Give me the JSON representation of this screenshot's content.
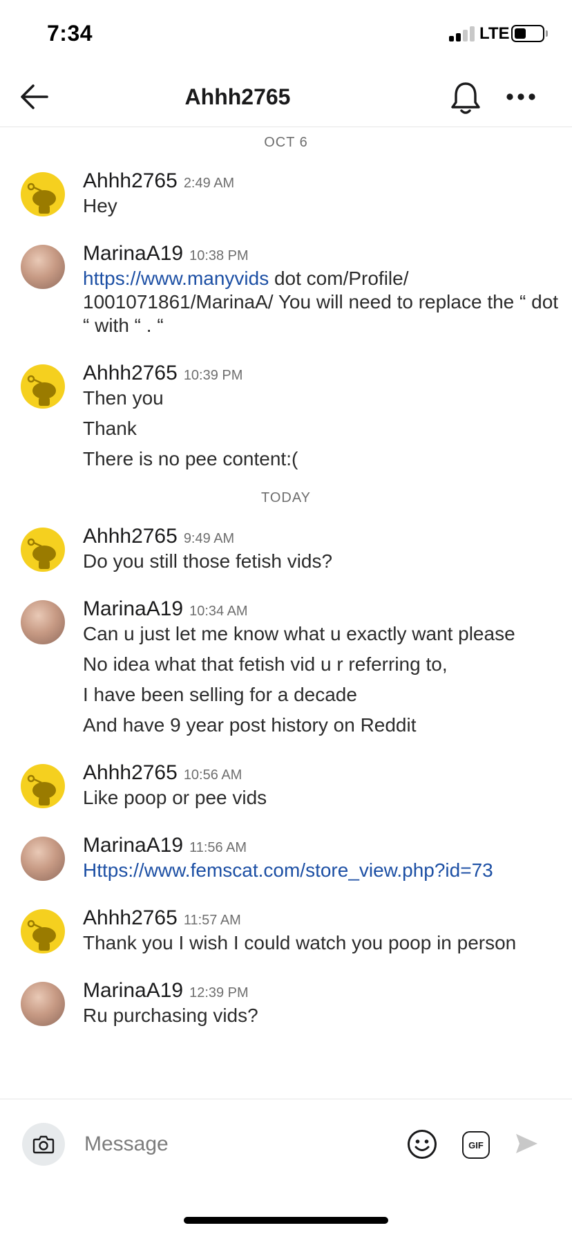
{
  "status_bar": {
    "time": "7:34",
    "network": "LTE"
  },
  "header": {
    "title": "Ahhh2765"
  },
  "chat": {
    "sections": [
      {
        "date": "OCT 6",
        "groups": [
          {
            "user": "Ahhh2765",
            "avatar": "snoo-avatar-icon",
            "time": "2:49 AM",
            "lines": [
              {
                "text": "Hey"
              }
            ]
          },
          {
            "user": "MarinaA19",
            "avatar": "photo-avatar",
            "time": "10:38 PM",
            "lines": [
              {
                "link": "https://www.manyvids",
                "text": " dot com/Profile/ 1001071861/MarinaA/  You will need to replace the “ dot “ with “ . “"
              }
            ]
          },
          {
            "user": "Ahhh2765",
            "avatar": "snoo-avatar-icon",
            "time": "10:39 PM",
            "lines": [
              {
                "text": "Then you"
              },
              {
                "text": "Thank"
              },
              {
                "text": "There is no pee content:("
              }
            ]
          }
        ]
      },
      {
        "date": "TODAY",
        "groups": [
          {
            "user": "Ahhh2765",
            "avatar": "snoo-avatar-icon",
            "time": "9:49 AM",
            "lines": [
              {
                "text": "Do you still those fetish vids?"
              }
            ]
          },
          {
            "user": "MarinaA19",
            "avatar": "photo-avatar",
            "time": "10:34 AM",
            "lines": [
              {
                "text": "Can u just let me know what u exactly want please"
              },
              {
                "text": "No idea what that fetish vid u r referring to,"
              },
              {
                "text": "I have been selling for a decade"
              },
              {
                "text": "And have 9 year post history on Reddit"
              }
            ]
          },
          {
            "user": "Ahhh2765",
            "avatar": "snoo-avatar-icon",
            "time": "10:56 AM",
            "lines": [
              {
                "text": "Like poop or pee vids"
              }
            ]
          },
          {
            "user": "MarinaA19",
            "avatar": "photo-avatar",
            "time": "11:56 AM",
            "lines": [
              {
                "link": "Https://www.femscat.com/store_view.php?id=73",
                "text": ""
              }
            ]
          },
          {
            "user": "Ahhh2765",
            "avatar": "snoo-avatar-icon",
            "time": "11:57 AM",
            "lines": [
              {
                "text": "Thank you I wish I could watch you poop in person"
              }
            ]
          },
          {
            "user": "MarinaA19",
            "avatar": "photo-avatar",
            "time": "12:39 PM",
            "lines": [
              {
                "text": "Ru purchasing vids?"
              }
            ]
          }
        ]
      }
    ]
  },
  "composer": {
    "placeholder": "Message",
    "gif_label": "GIF"
  },
  "icons": {
    "back": "arrow-left-icon",
    "bell": "bell-icon",
    "more": "more-horizontal-icon",
    "camera": "camera-icon",
    "emoji": "smiley-icon",
    "gif": "gif-icon",
    "send": "send-icon"
  },
  "colors": {
    "link": "#1c4fa4",
    "snoo_avatar_bg": "#f5d01f",
    "muted_text": "#6e6e6e",
    "send_disabled": "#c8c8c8"
  }
}
